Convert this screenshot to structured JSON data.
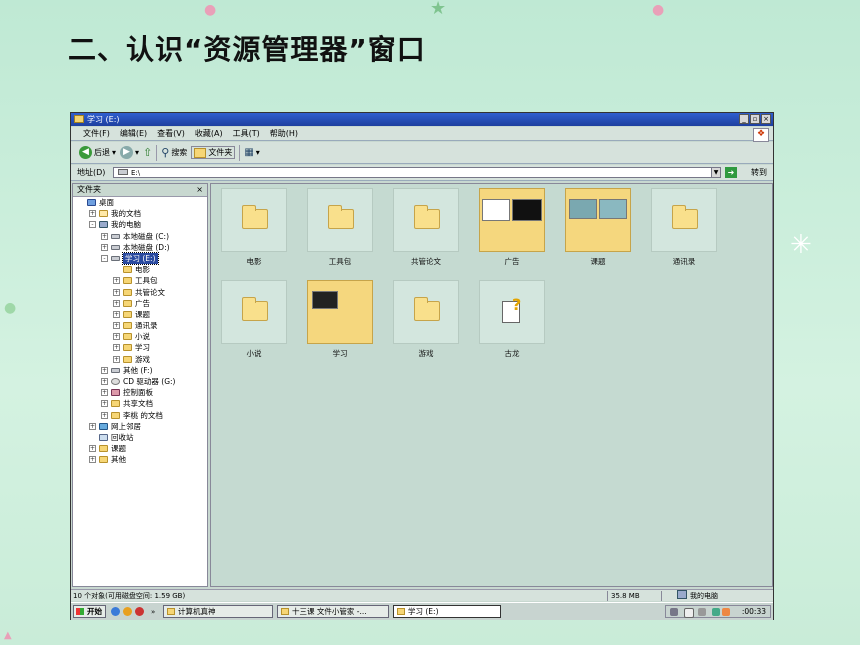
{
  "slide": {
    "title": "二、认识“资源管理器”窗口"
  },
  "window": {
    "title": "学习 (E:)",
    "controls": {
      "minimize": "_",
      "restore": "▫",
      "close": "×"
    },
    "menu": [
      "文件(F)",
      "编辑(E)",
      "查看(V)",
      "收藏(A)",
      "工具(T)",
      "帮助(H)"
    ],
    "toolbar": {
      "back": "后退",
      "search": "搜索",
      "folders": "文件夹"
    },
    "address": {
      "label": "地址(D)",
      "value": "E:\\",
      "go": "转到"
    },
    "tree": {
      "header": "文件夹",
      "close": "×",
      "items": [
        {
          "label": "桌面",
          "level": 0,
          "exp": "",
          "icon": "desk"
        },
        {
          "label": "我的文档",
          "level": 1,
          "exp": "+",
          "icon": "doc"
        },
        {
          "label": "我的电脑",
          "level": 1,
          "exp": "-",
          "icon": "comp"
        },
        {
          "label": "本地磁盘 (C:)",
          "level": 2,
          "exp": "+",
          "icon": "drive"
        },
        {
          "label": "本地磁盘 (D:)",
          "level": 2,
          "exp": "+",
          "icon": "drive"
        },
        {
          "label": "学习 (E:)",
          "level": 2,
          "exp": "-",
          "icon": "drive",
          "selected": true
        },
        {
          "label": "电影",
          "level": 3,
          "exp": "",
          "icon": "folder"
        },
        {
          "label": "工具包",
          "level": 3,
          "exp": "+",
          "icon": "folder"
        },
        {
          "label": "共管论文",
          "level": 3,
          "exp": "+",
          "icon": "folder"
        },
        {
          "label": "广告",
          "level": 3,
          "exp": "+",
          "icon": "folder"
        },
        {
          "label": "课题",
          "level": 3,
          "exp": "+",
          "icon": "folder"
        },
        {
          "label": "通讯录",
          "level": 3,
          "exp": "+",
          "icon": "folder"
        },
        {
          "label": "小说",
          "level": 3,
          "exp": "+",
          "icon": "folder"
        },
        {
          "label": "学习",
          "level": 3,
          "exp": "+",
          "icon": "folder"
        },
        {
          "label": "游戏",
          "level": 3,
          "exp": "+",
          "icon": "folder"
        },
        {
          "label": "其他 (F:)",
          "level": 2,
          "exp": "+",
          "icon": "drive"
        },
        {
          "label": "CD 驱动器 (G:)",
          "level": 2,
          "exp": "+",
          "icon": "cd"
        },
        {
          "label": "控制面板",
          "level": 2,
          "exp": "+",
          "icon": "ctl"
        },
        {
          "label": "共享文档",
          "level": 2,
          "exp": "+",
          "icon": "folder"
        },
        {
          "label": "李桃 的文档",
          "level": 2,
          "exp": "+",
          "icon": "folder"
        },
        {
          "label": "网上邻居",
          "level": 1,
          "exp": "+",
          "icon": "net"
        },
        {
          "label": "回收站",
          "level": 1,
          "exp": "",
          "icon": "bin"
        },
        {
          "label": "课题",
          "level": 1,
          "exp": "+",
          "icon": "folder"
        },
        {
          "label": "其他",
          "level": 1,
          "exp": "+",
          "icon": "folder"
        }
      ]
    },
    "items": [
      {
        "label": "电影",
        "type": "folder"
      },
      {
        "label": "工具包",
        "type": "folder"
      },
      {
        "label": "共管论文",
        "type": "folder"
      },
      {
        "label": "广告",
        "type": "thumbs"
      },
      {
        "label": "课题",
        "type": "thumbs"
      },
      {
        "label": "通讯录",
        "type": "folder"
      },
      {
        "label": "小说",
        "type": "folder"
      },
      {
        "label": "学习",
        "type": "thumbs"
      },
      {
        "label": "游戏",
        "type": "folder"
      },
      {
        "label": "古龙",
        "type": "help"
      }
    ],
    "status": {
      "objects": "10 个对象(可用磁盘空间: 1.59 GB)",
      "size": "35.8 MB",
      "location": "我的电脑"
    }
  },
  "taskbar": {
    "start": "开始",
    "tasks": [
      "计算机真神",
      "十三课 文件小管家 -...",
      "学习 (E:)"
    ],
    "clock": ":00:33"
  }
}
